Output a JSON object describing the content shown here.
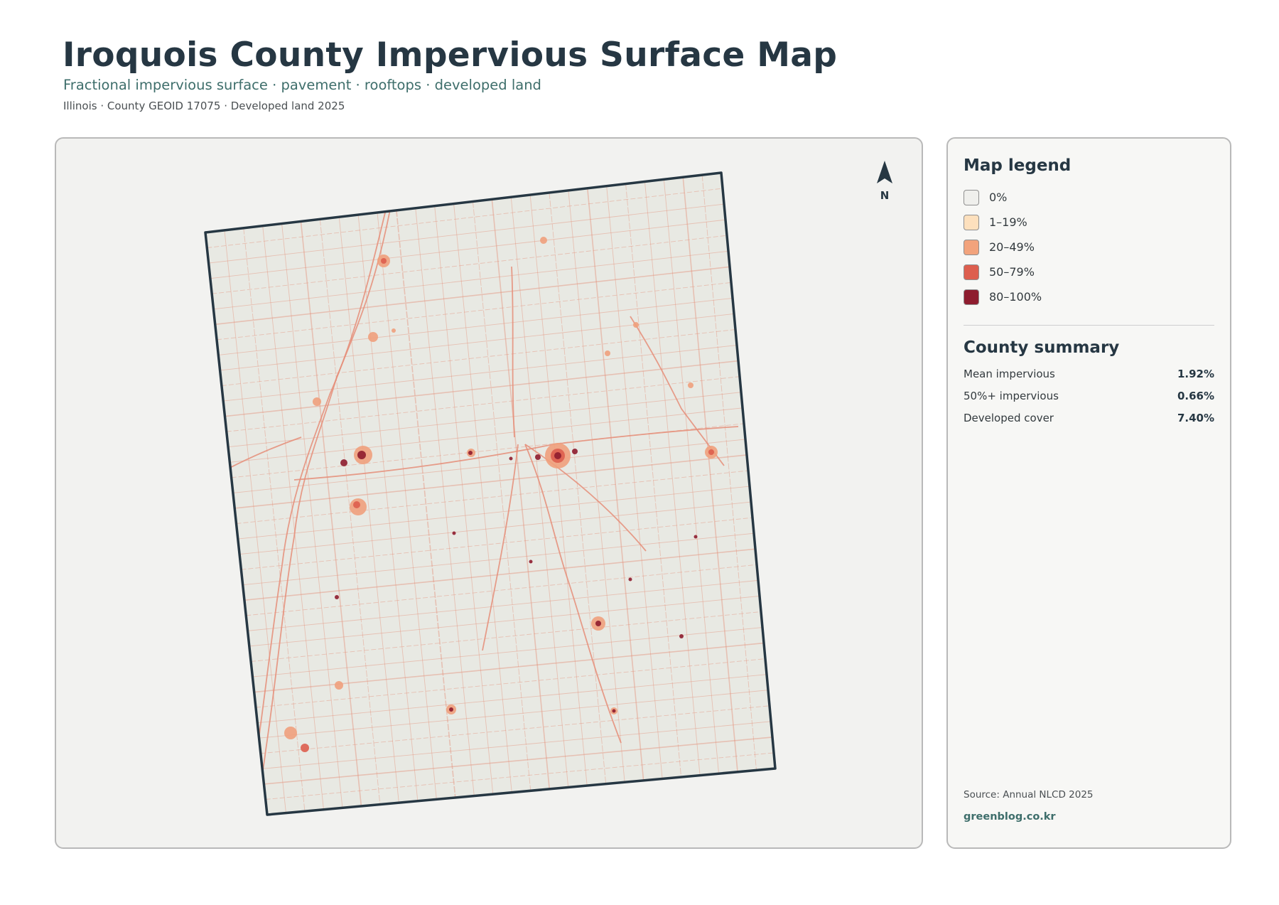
{
  "header": {
    "title": "Iroquois County Impervious Surface Map",
    "subtitle": "Fractional impervious surface · pavement · rooftops · developed land",
    "meta": "Illinois · County GEOID 17075 · Developed land 2025"
  },
  "map": {
    "north_label": "N",
    "colors": {
      "county_fill": "#e8e9e3",
      "county_outline": "#263743",
      "road": "#e58d78",
      "town_light": "#f0a07c",
      "town_mid": "#dd5e4e",
      "town_core": "#8e1c2e",
      "north_arrow": "#263743"
    }
  },
  "legend": {
    "title": "Map legend",
    "items": [
      {
        "label": "0%",
        "color": "#efefec"
      },
      {
        "label": "1–19%",
        "color": "#fde0bd"
      },
      {
        "label": "20–49%",
        "color": "#f2a37c"
      },
      {
        "label": "50–79%",
        "color": "#dd5e4e"
      },
      {
        "label": "80–100%",
        "color": "#8e1c2e"
      }
    ]
  },
  "summary": {
    "title": "County summary",
    "stats": [
      {
        "label": "Mean impervious",
        "value": "1.92%"
      },
      {
        "label": "50%+ impervious",
        "value": "0.66%"
      },
      {
        "label": "Developed cover",
        "value": "7.40%"
      }
    ]
  },
  "footer": {
    "source": "Source: Annual NLCD 2025",
    "brand": "greenblog.co.kr"
  }
}
